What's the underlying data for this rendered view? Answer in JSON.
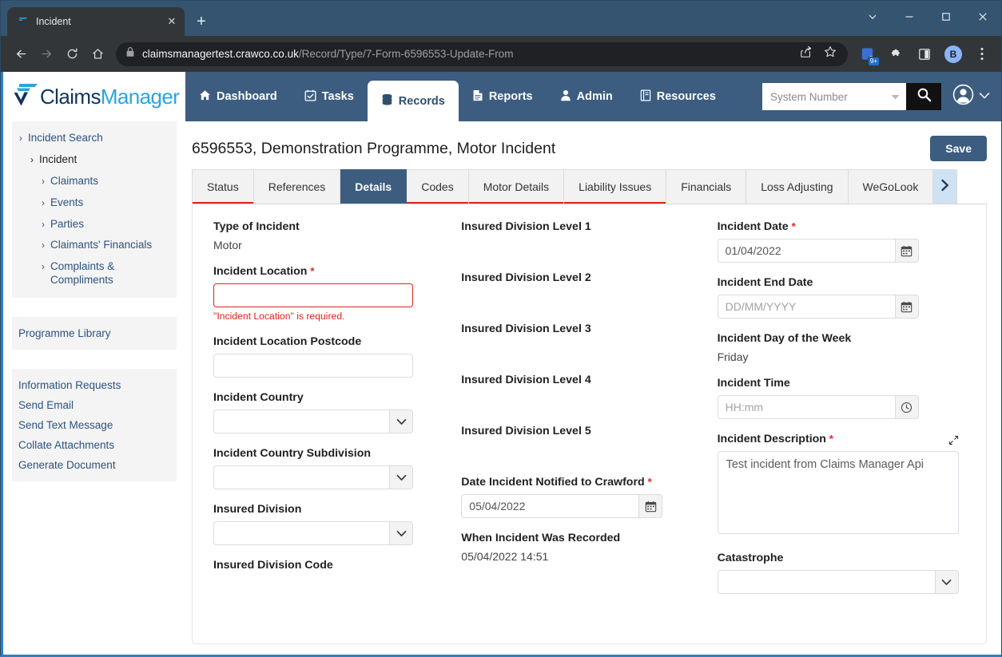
{
  "browser": {
    "tab_title": "Incident",
    "tab_close": "✕",
    "new_tab": "+",
    "url_domain": "claimsmanagertest.crawco.co.uk",
    "url_path": "/Record/Type/7-Form-6596553-Update-From",
    "extension_badge": "9+",
    "profile_initial": "B",
    "window_minimize": "—",
    "window_maximize": "☐",
    "window_close": "✕"
  },
  "logo": {
    "part1": "Claims",
    "part2": "Manager"
  },
  "sidebar": {
    "tree": [
      {
        "label": "Incident Search",
        "level": 1,
        "current": false
      },
      {
        "label": "Incident",
        "level": 2,
        "current": true
      },
      {
        "label": "Claimants",
        "level": 3,
        "current": false
      },
      {
        "label": "Events",
        "level": 3,
        "current": false
      },
      {
        "label": "Parties",
        "level": 3,
        "current": false
      },
      {
        "label": "Claimants' Financials",
        "level": 3,
        "current": false
      },
      {
        "label": "Complaints & Compliments",
        "level": 3,
        "current": false
      }
    ],
    "library": "Programme Library",
    "actions": [
      "Information Requests",
      "Send Email",
      "Send Text Message",
      "Collate Attachments",
      "Generate Document"
    ]
  },
  "navbar": {
    "items": [
      {
        "label": "Dashboard",
        "icon": "home-icon",
        "active": false
      },
      {
        "label": "Tasks",
        "icon": "calendar-check-icon",
        "active": false
      },
      {
        "label": "Records",
        "icon": "database-icon",
        "active": true
      },
      {
        "label": "Reports",
        "icon": "document-icon",
        "active": false
      },
      {
        "label": "Admin",
        "icon": "user-icon",
        "active": false
      },
      {
        "label": "Resources",
        "icon": "book-icon",
        "active": false
      }
    ],
    "search_select": "System Number",
    "search_button": "search-icon"
  },
  "page": {
    "title": "6596553, Demonstration Programme, Motor Incident",
    "save_label": "Save"
  },
  "tabs": [
    {
      "label": "Status",
      "active": false,
      "error": true
    },
    {
      "label": "References",
      "active": false,
      "error": false
    },
    {
      "label": "Details",
      "active": true,
      "error": false
    },
    {
      "label": "Codes",
      "active": false,
      "error": true
    },
    {
      "label": "Motor Details",
      "active": false,
      "error": true
    },
    {
      "label": "Liability Issues",
      "active": false,
      "error": true
    },
    {
      "label": "Financials",
      "active": false,
      "error": false
    },
    {
      "label": "Loss Adjusting",
      "active": false,
      "error": false
    },
    {
      "label": "WeGoLook",
      "active": false,
      "error": false
    }
  ],
  "tabs_next_arrow": "›",
  "form": {
    "type_of_incident": {
      "label": "Type of Incident",
      "value": "Motor"
    },
    "incident_location": {
      "label": "Incident Location",
      "required": "*",
      "value": "",
      "error": "\"Incident Location\" is required."
    },
    "incident_location_postcode": {
      "label": "Incident Location Postcode",
      "value": ""
    },
    "incident_country": {
      "label": "Incident Country",
      "value": ""
    },
    "incident_country_subdivision": {
      "label": "Incident Country Subdivision",
      "value": ""
    },
    "insured_division": {
      "label": "Insured Division",
      "value": ""
    },
    "insured_division_code": {
      "label": "Insured Division Code",
      "value": ""
    },
    "insured_division_level_1": {
      "label": "Insured Division Level 1",
      "value": ""
    },
    "insured_division_level_2": {
      "label": "Insured Division Level 2",
      "value": ""
    },
    "insured_division_level_3": {
      "label": "Insured Division Level 3",
      "value": ""
    },
    "insured_division_level_4": {
      "label": "Insured Division Level 4",
      "value": ""
    },
    "insured_division_level_5": {
      "label": "Insured Division Level 5",
      "value": ""
    },
    "date_notified": {
      "label": "Date Incident Notified to Crawford",
      "required": "*",
      "value": "05/04/2022"
    },
    "when_recorded": {
      "label": "When Incident Was Recorded",
      "value": "05/04/2022 14:51"
    },
    "incident_date": {
      "label": "Incident Date",
      "required": "*",
      "value": "01/04/2022"
    },
    "incident_end_date": {
      "label": "Incident End Date",
      "value": "",
      "placeholder": "DD/MM/YYYY"
    },
    "incident_day_of_week": {
      "label": "Incident Day of the Week",
      "value": "Friday"
    },
    "incident_time": {
      "label": "Incident Time",
      "value": "",
      "placeholder": "HH:mm"
    },
    "incident_description": {
      "label": "Incident Description",
      "required": "*",
      "value": "Test incident from Claims Manager Api"
    },
    "catastrophe": {
      "label": "Catastrophe",
      "value": ""
    }
  },
  "colors": {
    "nav_blue": "#3c5d80",
    "accent_blue": "#2d7fc1",
    "error_red": "#e2231a",
    "link_blue": "#2c5282"
  }
}
